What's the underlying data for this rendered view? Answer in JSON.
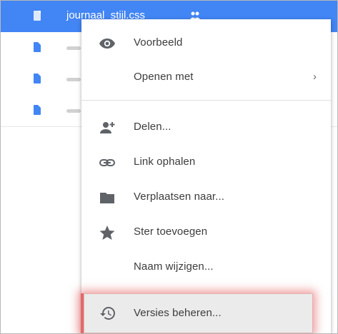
{
  "file_list": {
    "selected_file_name": "journaal_stijl.css",
    "rows": [
      {
        "selected": true
      },
      {
        "selected": false
      },
      {
        "selected": false
      },
      {
        "selected": false
      }
    ]
  },
  "context_menu": {
    "items": [
      {
        "label": "Voorbeeld",
        "icon": "eye-icon"
      },
      {
        "label": "Openen met",
        "icon": "",
        "submenu": "›"
      },
      {
        "label": "Delen...",
        "icon": "person-add-icon"
      },
      {
        "label": "Link ophalen",
        "icon": "link-icon"
      },
      {
        "label": "Verplaatsen naar...",
        "icon": "folder-icon"
      },
      {
        "label": "Ster toevoegen",
        "icon": "star-icon"
      },
      {
        "label": "Naam wijzigen...",
        "icon": ""
      },
      {
        "label": "Versies beheren...",
        "icon": "history-icon"
      }
    ]
  },
  "colors": {
    "selection": "#4285f4",
    "icon": "#5f6368",
    "highlight_glow": "#e06a6a"
  }
}
